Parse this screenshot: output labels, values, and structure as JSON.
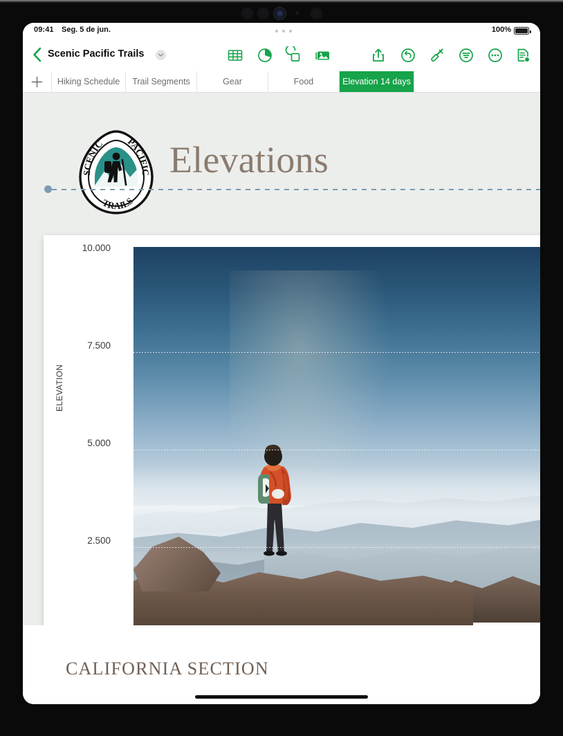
{
  "status_bar": {
    "time": "09:41",
    "date": "Seg. 5 de jun.",
    "battery_percent": "100%",
    "battery_icon": "battery-full-icon",
    "activity_dots_icon": "three-dots-icon"
  },
  "nav_bar": {
    "back_icon": "chevron-left-icon",
    "document_title": "Scenic Pacific Trails",
    "title_menu_icon": "chevron-down-icon",
    "tools": [
      {
        "name": "insert-table",
        "icon": "table-icon"
      },
      {
        "name": "insert-chart",
        "icon": "pie-chart-icon"
      },
      {
        "name": "insert-shape",
        "icon": "shapes-icon"
      },
      {
        "name": "insert-media",
        "icon": "photo-icon"
      },
      {
        "name": "share",
        "icon": "share-up-arrow-icon"
      },
      {
        "name": "undo",
        "icon": "undo-arrow-icon"
      },
      {
        "name": "format-brush",
        "icon": "paintbrush-icon"
      },
      {
        "name": "format-panel",
        "icon": "format-lines-icon"
      },
      {
        "name": "more-options",
        "icon": "ellipsis-circle-icon"
      },
      {
        "name": "document-options",
        "icon": "document-badge-icon"
      }
    ]
  },
  "sheet_tabs": {
    "add_icon": "plus-icon",
    "items": [
      {
        "label": "Hiking Schedule",
        "active": false
      },
      {
        "label": "Trail Segments",
        "active": false
      },
      {
        "label": "Gear",
        "active": false
      },
      {
        "label": "Food",
        "active": false
      },
      {
        "label": "Elevation 14 days",
        "active": true
      }
    ],
    "active_color": "#16a34a"
  },
  "canvas": {
    "sheet_title": "Elevations",
    "sheet_title_color": "#8b7c70",
    "background_color": "#eceeec",
    "logo": {
      "name": "scenic-pacific-trails-badge",
      "top_text": "SCENIC",
      "top_right_text": "PACIFIC",
      "bottom_text": "TRAILS",
      "shield_color": "#2a9188",
      "outline_color": "#101010"
    },
    "selection_handle_color": "#7d9cb1",
    "next_section_heading": "CALIFORNIA SECTION"
  },
  "chart_data": {
    "type": "area",
    "title": "",
    "xlabel": "",
    "ylabel": "ELEVATION",
    "ytick_labels": [
      "10.000",
      "7.500",
      "5.000",
      "2.500"
    ],
    "ytick_values": [
      10000,
      7500,
      5000,
      2500
    ],
    "ylim": [
      0,
      10000
    ],
    "grid": true,
    "grid_style": "dotted",
    "legend": "none",
    "plot_fill": "photo-fill",
    "photo": {
      "name": "hiker-overlooking-mountain-valley",
      "subject": "hiker in orange jacket with backpack on rocky summit",
      "sky_top_color": "#1d4162",
      "sky_bottom_color": "#dde6ec",
      "rock_color": "#6d5849",
      "jacket_color": "#d4502a"
    }
  }
}
